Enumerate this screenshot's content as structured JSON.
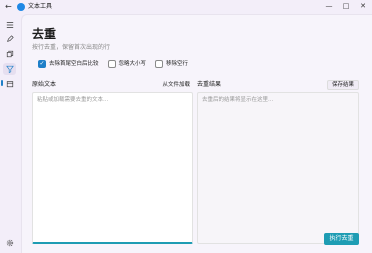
{
  "window": {
    "title": "文本工具",
    "back_icon": "←",
    "minimize": "—",
    "maximize": "□",
    "close": "✕"
  },
  "page": {
    "title": "去重",
    "subtitle": "按行去重，保留首次出现的行"
  },
  "options": [
    {
      "label": "去除首尾空白后比较",
      "checked": true
    },
    {
      "label": "忽略大小写",
      "checked": false
    },
    {
      "label": "移除空行",
      "checked": false
    }
  ],
  "input_panel": {
    "label": "原始文本",
    "load_button": "从文件加载",
    "placeholder": "粘贴或加载需要去重的文本..."
  },
  "output_panel": {
    "label": "去重结果",
    "save_button": "保存结果",
    "placeholder": "去重后的结果将显示在这里..."
  },
  "run_button": "执行去重",
  "colors": {
    "accent": "#1e9cb3",
    "checkbox": "#1e7fc8",
    "brand": "#1e88e5"
  }
}
